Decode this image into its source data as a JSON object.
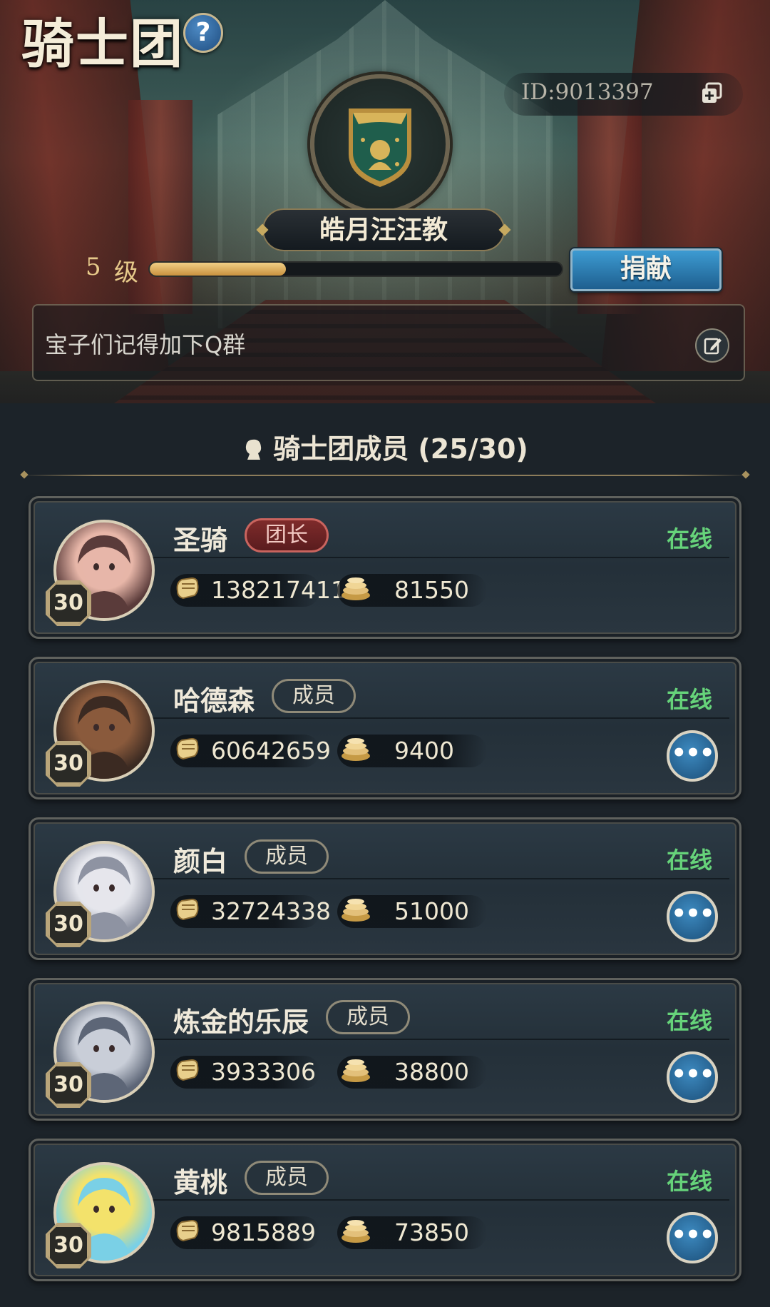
{
  "header": {
    "title": "骑士团",
    "help_label": "?",
    "guild_id": "ID:9013397",
    "guild_name": "皓月汪汪教",
    "level_number": "5",
    "level_unit": "级",
    "level_progress": 0.33,
    "donate_label": "捐献",
    "notice": "宝子们记得加下Q群"
  },
  "members": {
    "heading": "骑士团成员 (25/30)",
    "list": [
      {
        "name": "圣骑",
        "role": "团长",
        "role_type": "leader",
        "status": "在线",
        "level": "30",
        "power": "138217411",
        "contribution": "81550",
        "show_more": false,
        "avatar_colors": [
          "#e7b6a8",
          "#5a3b3a"
        ]
      },
      {
        "name": "哈德森",
        "role": "成员",
        "role_type": "member",
        "status": "在线",
        "level": "30",
        "power": "60642659",
        "contribution": "9400",
        "show_more": true,
        "avatar_colors": [
          "#8a5a3c",
          "#3b2a22"
        ]
      },
      {
        "name": "颜白",
        "role": "成员",
        "role_type": "member",
        "status": "在线",
        "level": "30",
        "power": "32724338",
        "contribution": "51000",
        "show_more": true,
        "avatar_colors": [
          "#e5e6ec",
          "#8e93a2"
        ]
      },
      {
        "name": "炼金的乐辰",
        "role": "成员",
        "role_type": "member",
        "status": "在线",
        "level": "30",
        "power": "3933306",
        "contribution": "38800",
        "show_more": true,
        "avatar_colors": [
          "#c9ced8",
          "#5d6677"
        ]
      },
      {
        "name": "黄桃",
        "role": "成员",
        "role_type": "member",
        "status": "在线",
        "level": "30",
        "power": "9815889",
        "contribution": "73850",
        "show_more": true,
        "avatar_colors": [
          "#f3e26b",
          "#7ad0e6"
        ]
      }
    ]
  },
  "more_label": "•••"
}
